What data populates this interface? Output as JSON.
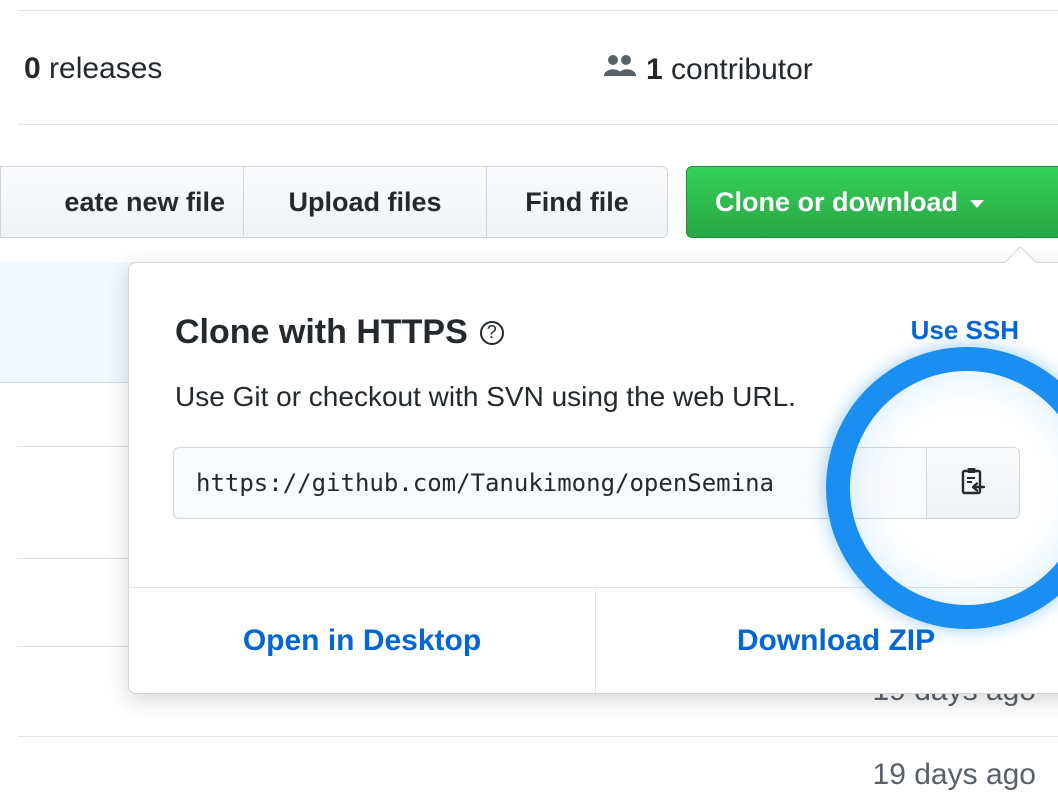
{
  "repo_stats": {
    "releases_count": "0",
    "releases_label": " releases",
    "contributors_count": "1",
    "contributors_label": " contributor"
  },
  "toolbar": {
    "create_label": "eate new file",
    "upload_label": "Upload files",
    "find_label": "Find file",
    "clone_label": "Clone or download"
  },
  "clone_panel": {
    "title": "Clone with HTTPS",
    "help_glyph": "?",
    "use_ssh_label": "Use SSH",
    "description": "Use Git or checkout with SVN using the web URL.",
    "url_value": "https://github.com/Tanukimong/openSemina",
    "copy_icon": "clipboard-icon",
    "open_desktop_label": "Open in Desktop",
    "download_zip_label": "Download ZIP"
  },
  "file_rows": {
    "age_1": "19 days ago",
    "age_2": "19 days ago"
  },
  "colors": {
    "primary_green": "#28a745",
    "link_blue": "#0366d6",
    "highlight_ring": "#1b8ef2"
  }
}
